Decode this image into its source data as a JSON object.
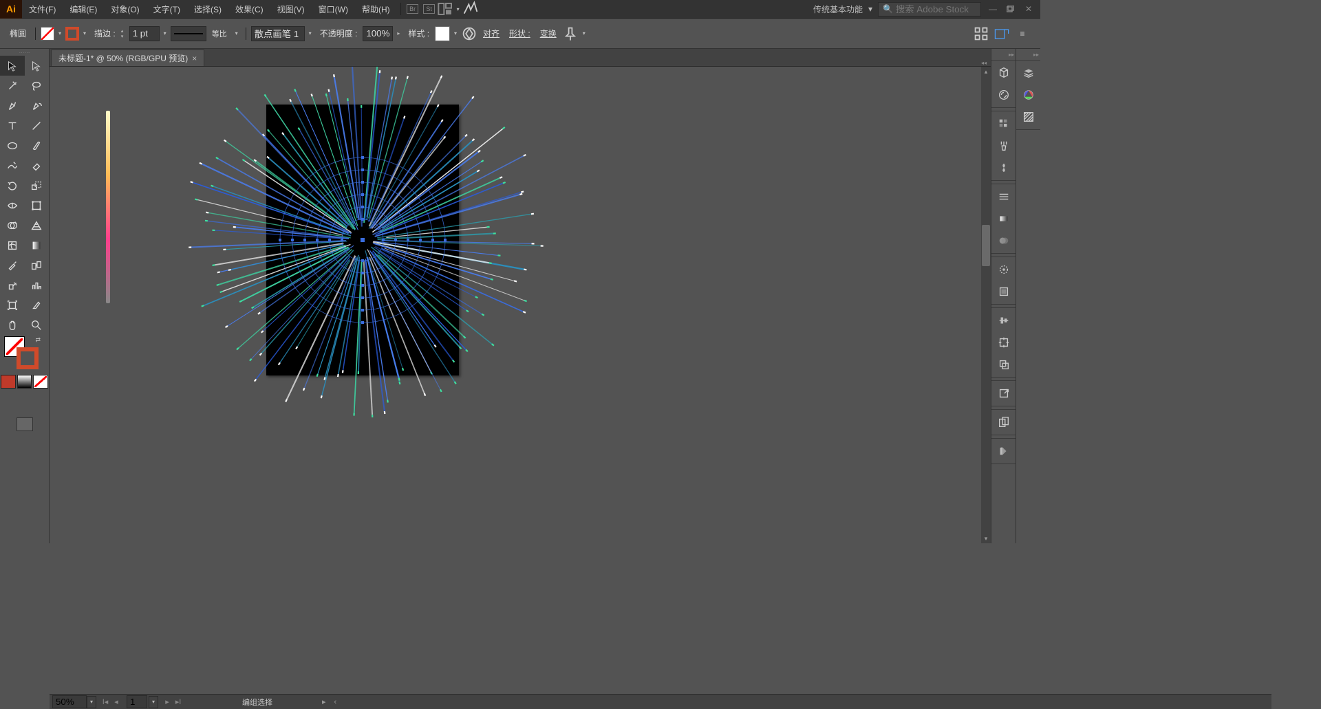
{
  "menu": {
    "items": [
      "文件(F)",
      "编辑(E)",
      "对象(O)",
      "文字(T)",
      "选择(S)",
      "效果(C)",
      "视图(V)",
      "窗口(W)",
      "帮助(H)"
    ]
  },
  "workspace": {
    "label": "传统基本功能"
  },
  "search": {
    "placeholder": "搜索 Adobe Stock"
  },
  "control": {
    "shape_label": "椭圆",
    "stroke_label": "描边 :",
    "stroke_weight": "1 pt",
    "profile_label": "等比",
    "brush": "散点画笔 1",
    "opacity_label": "不透明度 :",
    "opacity": "100%",
    "style_label": "样式 :",
    "align_label": "对齐",
    "shape2_label": "形状 :",
    "transform_label": "变换"
  },
  "tab": {
    "title": "未标题-1* @ 50% (RGB/GPU 预览)"
  },
  "status": {
    "zoom": "50%",
    "artboard": "1",
    "selection": "编组选择"
  }
}
